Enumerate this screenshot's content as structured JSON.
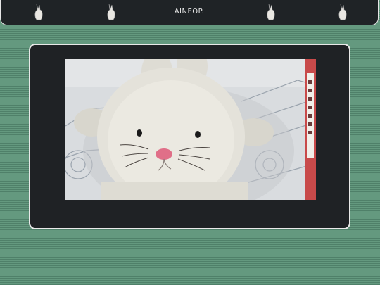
{
  "header": {
    "brand_text": "AINEOP.",
    "nav_icons": [
      "bunny-icon",
      "bunny-icon",
      "bunny-icon",
      "bunny-icon"
    ]
  },
  "viewer": {
    "image_content": "plush-bunny-photo"
  },
  "colors": {
    "background": "#5f957c",
    "bar": "#1f2326",
    "frame": "#1f2225",
    "border": "#e9e9e9"
  }
}
